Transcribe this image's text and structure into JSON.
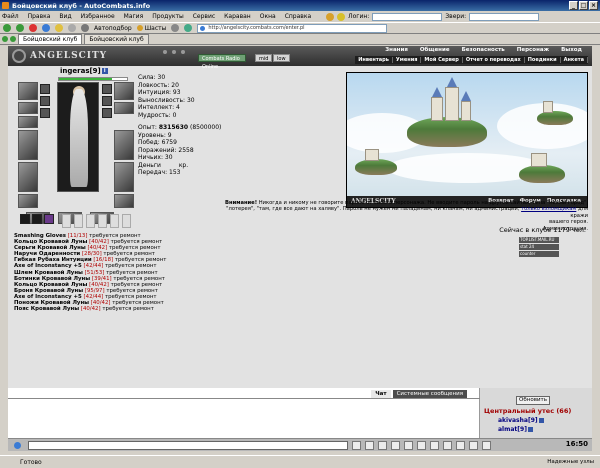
{
  "window": {
    "title": "Бойцовский клуб - AutoCombats.info"
  },
  "menu": {
    "items": [
      "Файл",
      "Правка",
      "Вид",
      "Избранное",
      "Магия",
      "Продукты",
      "Сервис",
      "Караван",
      "Окна",
      "Справка"
    ],
    "login_label": "Логин:",
    "beasts_label": "Звери:"
  },
  "toolbar": {
    "autofill_label": "Автоподбор",
    "parts_label": "Шасты",
    "address": "http://angelscity.combats.com/enter.pl"
  },
  "tabs": [
    {
      "label": "Бойцовский клуб",
      "active": true
    },
    {
      "label": "Бойцовский клуб",
      "active": false
    }
  ],
  "game": {
    "logo": "ANGELSCITY",
    "radio_label": "Combats Radio Online",
    "btn_mid": "mid",
    "btn_low": "low",
    "nav_top": [
      "Знания",
      "Общение",
      "Безопасность",
      "Персонаж",
      "Выход"
    ],
    "nav_sub": [
      "Инвентарь",
      "Умения",
      "Мой Сервер",
      "Отчет о переводах",
      "Поединки",
      "Анкета"
    ]
  },
  "character": {
    "name": "ingeras",
    "level": "[9]",
    "level_icon": "i",
    "hp_fraction": 0.78
  },
  "stats": {
    "strength": "Сила: 30",
    "agility": "Ловкость: 20",
    "intuition": "Интуиция: 93",
    "endurance": "Выносливость: 30",
    "intellect": "Интеллект: 4",
    "wisdom": "Мудрость: 0",
    "exp_label": "Опыт:",
    "exp_value": "8315630",
    "exp_next": "(8500000)",
    "level": "Уровень: 9",
    "wins": "Побед: 6759",
    "losses": "Поражений: 2558",
    "draws": "Ничьих: 30",
    "money": "Деньги",
    "money_unit": "кр.",
    "transfers": "Передач: 153"
  },
  "art": {
    "logo": "ANGELSCITY",
    "links": [
      "Возврат",
      "Форум",
      "Подсказка"
    ]
  },
  "warning": {
    "bold": "Внимание!",
    "line1": " Никогда и никому не говорите пароль от своего персонажа. Не вводите пароль на других сайтах, типа \"новый город\",",
    "line2a": "\"лотерея\", \"там, где все дают на халяву\". Пароль не нужен ни паладинам, ни кланам, ни администрации, ",
    "line2_link": "только взломщикам",
    "line2b": " для кражи",
    "line3": "вашего героя.",
    "signature": "Администрация."
  },
  "online": "Сейчас в клубе 1179 чел.",
  "counters": [
    "TOP.LIST.MAIL.RU",
    "stat 24",
    "counter"
  ],
  "items": [
    {
      "name": "Smashing Gloves",
      "dur": "[11/13]",
      "note": "требуется ремонт"
    },
    {
      "name": "Кольцо Кровавой Луны",
      "dur": "[40/42]",
      "note": "требуется ремонт"
    },
    {
      "name": "Серьги Кровавой Луны",
      "dur": "[40/42]",
      "note": "требуется ремонт"
    },
    {
      "name": "Наручи Одаренности",
      "dur": "[28/30]",
      "note": "требуется ремонт"
    },
    {
      "name": "Гибкая Рубаха Интуиции",
      "dur": "[16/18]",
      "note": "требуется ремонт"
    },
    {
      "name": "Axe of Inconstancy +5",
      "dur": "[42/44]",
      "note": "требуется ремонт"
    },
    {
      "name": "Шлем Кровавой Луны",
      "dur": "[51/53]",
      "note": "требуется ремонт"
    },
    {
      "name": "Ботинки Кровавой Луны",
      "dur": "[39/41]",
      "note": "требуется ремонт"
    },
    {
      "name": "Кольцо Кровавой Луны",
      "dur": "[40/42]",
      "note": "требуется ремонт"
    },
    {
      "name": "Броня Кровавой Луны",
      "dur": "[95/97]",
      "note": "требуется ремонт"
    },
    {
      "name": "Axe of Inconstancy +5",
      "dur": "[42/44]",
      "note": "требуется ремонт"
    },
    {
      "name": "Поножи Кровавой Луны",
      "dur": "[40/42]",
      "note": "требуется ремонт"
    },
    {
      "name": "Пояс Кровавой Луны",
      "dur": "[40/42]",
      "note": "требуется ремонт"
    }
  ],
  "chat": {
    "tab_chat": "Чат",
    "tab_system": "Системные сообщения",
    "refresh": "Обновить",
    "room": "Центральный утес (66)",
    "users": [
      {
        "name": "akivasha",
        "level": "[9]"
      },
      {
        "name": "almat",
        "level": "[9]"
      }
    ],
    "clock": "16:50"
  },
  "statusbar": {
    "status": "Готово",
    "zone": "Надежные узлы"
  }
}
